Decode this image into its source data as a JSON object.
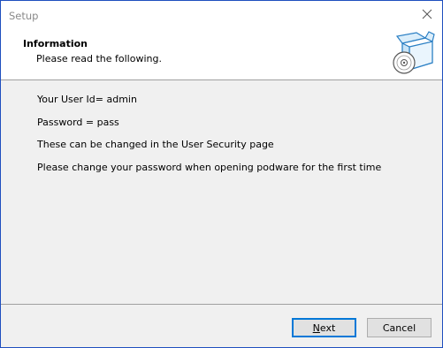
{
  "window": {
    "title": "Setup"
  },
  "header": {
    "title": "Information",
    "subtitle": "Please read the following.",
    "icon": "setup-box-cd-icon"
  },
  "content": {
    "lines": [
      "Your User Id= admin",
      "Password = pass",
      "These can be changed in the User Security page",
      "Please change your password when opening podware for the first time"
    ]
  },
  "buttons": {
    "next_accel": "N",
    "next_rest": "ext",
    "cancel": "Cancel"
  },
  "colors": {
    "window_border": "#1f4fbf",
    "default_button_border": "#0078d7",
    "dialog_background": "#f0f0f0"
  }
}
